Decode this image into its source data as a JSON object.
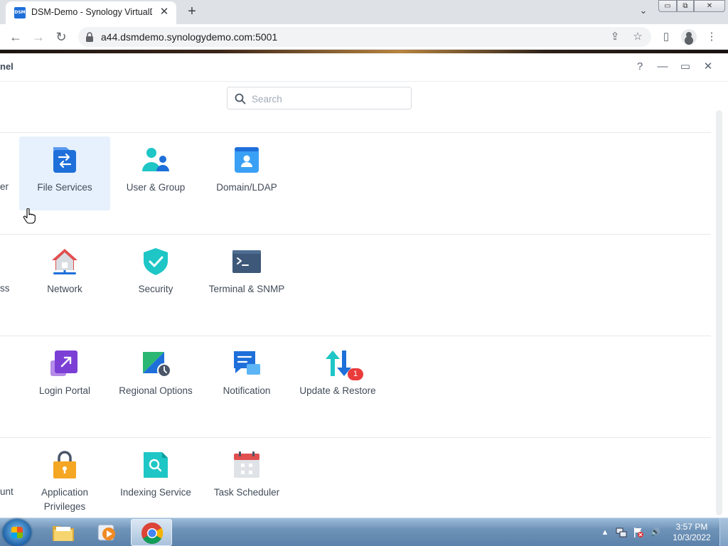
{
  "browser": {
    "tab": {
      "title": "DSM-Demo - Synology VirtualDSM",
      "favicon_text": "DSM",
      "close": "✕"
    },
    "new_tab": "+",
    "tab_strip_menu": "⌄",
    "window_controls": {
      "minimize": "▭",
      "restore": "⧉",
      "close": "✕"
    },
    "nav": {
      "back": "←",
      "forward": "→",
      "reload": "↻"
    },
    "address": "a44.dsmdemo.synologydemo.com:5001",
    "icons": {
      "share": "⇪",
      "bookmark": "☆",
      "side_panel": "▯",
      "menu": "⋮"
    }
  },
  "dsm": {
    "title": "nel",
    "controls": {
      "help": "?",
      "minimize": "—",
      "maximize": "▭",
      "close": "✕"
    },
    "search": {
      "placeholder": "Search",
      "value": ""
    },
    "rows": [
      {
        "partial_label": "er",
        "items": [
          {
            "label": "File Services",
            "icon": "file-services-icon",
            "selected": true
          },
          {
            "label": "User & Group",
            "icon": "user-group-icon"
          },
          {
            "label": "Domain/LDAP",
            "icon": "domain-ldap-icon"
          }
        ]
      },
      {
        "partial_label": "ss",
        "items": [
          {
            "label": "Network",
            "icon": "network-icon"
          },
          {
            "label": "Security",
            "icon": "security-shield-icon"
          },
          {
            "label": "Terminal & SNMP",
            "icon": "terminal-icon"
          }
        ]
      },
      {
        "partial_label": "",
        "items": [
          {
            "label": "Login Portal",
            "icon": "login-portal-icon"
          },
          {
            "label": "Regional Options",
            "icon": "regional-options-icon"
          },
          {
            "label": "Notification",
            "icon": "notification-icon"
          },
          {
            "label": "Update & Restore",
            "icon": "update-restore-icon",
            "badge": "1"
          }
        ]
      },
      {
        "partial_label": "unt",
        "items": [
          {
            "label": "Application",
            "label2": "Privileges",
            "icon": "application-privileges-icon"
          },
          {
            "label": "Indexing Service",
            "icon": "indexing-service-icon"
          },
          {
            "label": "Task Scheduler",
            "icon": "task-scheduler-icon"
          }
        ]
      }
    ]
  },
  "taskbar": {
    "time": "3:57 PM",
    "date": "10/3/2022",
    "tray": {
      "arrow": "▲",
      "volume": "🔊"
    }
  },
  "colors": {
    "accent": "#1e6fd9",
    "selected_tile": "#e6f1fd",
    "badge": "#ea3b3b",
    "teal": "#1ec6c6"
  }
}
